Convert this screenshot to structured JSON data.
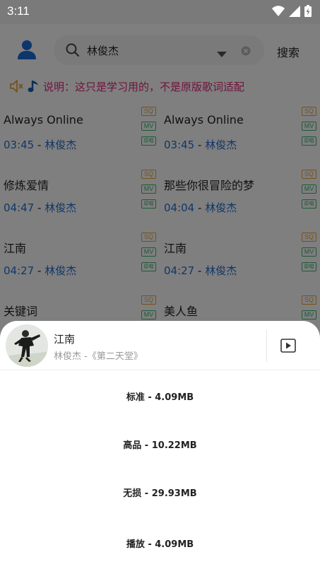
{
  "status": {
    "time": "3:11"
  },
  "search": {
    "query": "林俊杰",
    "button": "搜索"
  },
  "notice": {
    "text": "说明：这只是学习用的，不是原版歌词适配"
  },
  "songs": [
    {
      "title": "Always Online",
      "duration": "03:45",
      "separator": " - ",
      "artist": "林俊杰",
      "badges": [
        "SQ",
        "MV",
        "原唱"
      ]
    },
    {
      "title": "Always Online",
      "duration": "03:45",
      "separator": " - ",
      "artist": "林俊杰",
      "badges": [
        "SQ",
        "MV",
        "原唱"
      ]
    },
    {
      "title": "修炼爱情",
      "duration": "04:47",
      "separator": " - ",
      "artist": "林俊杰",
      "badges": [
        "SQ",
        "MV",
        "原唱"
      ]
    },
    {
      "title": "那些你很冒险的梦",
      "duration": "04:04",
      "separator": " - ",
      "artist": "林俊杰",
      "badges": [
        "SQ",
        "MV",
        "原唱"
      ]
    },
    {
      "title": "江南",
      "duration": "04:27",
      "separator": " - ",
      "artist": "林俊杰",
      "badges": [
        "SQ",
        "MV",
        "原唱"
      ]
    },
    {
      "title": "江南",
      "duration": "04:27",
      "separator": " - ",
      "artist": "林俊杰",
      "badges": [
        "SQ",
        "MV",
        "原唱"
      ]
    },
    {
      "title": "关键词",
      "duration": "",
      "separator": "",
      "artist": "",
      "badges": [
        "SQ",
        "MV"
      ]
    },
    {
      "title": "美人鱼",
      "duration": "",
      "separator": "",
      "artist": "",
      "badges": [
        "SQ",
        "MV"
      ]
    }
  ],
  "sheet": {
    "title": "江南",
    "subtitle": "林俊杰 -《第二天堂》",
    "options": [
      "标准 - 4.09MB",
      "高品 - 10.22MB",
      "无损 - 29.93MB",
      "播放 - 4.09MB"
    ]
  },
  "colors": {
    "accent_blue": "#1f6fd1",
    "notice_pink": "#e0267a",
    "sq_badge": "#e8a33a",
    "mv_badge": "#3cb371"
  },
  "icons": {
    "user": "person-icon",
    "search": "search-icon",
    "dropdown": "triangle-down-icon",
    "clear": "clear-circle-icon",
    "speaker": "speaker-mute-icon",
    "note": "music-note-icon",
    "mv": "play-video-icon"
  }
}
